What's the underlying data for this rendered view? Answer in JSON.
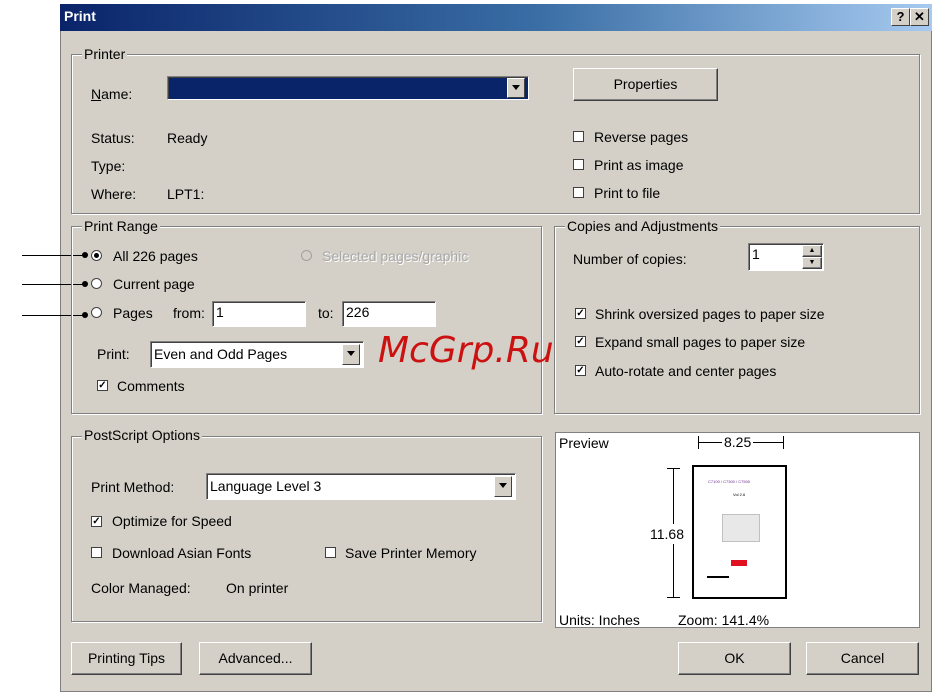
{
  "window": {
    "title": "Print",
    "help_btn": "?",
    "close_btn": "✕"
  },
  "printer": {
    "legend": "Printer",
    "name_label": "Name:",
    "name_value": "",
    "properties_button": "Properties",
    "status_label": "Status:",
    "status_value": "Ready",
    "type_label": "Type:",
    "type_value": "",
    "where_label": "Where:",
    "where_value": "LPT1:",
    "reverse_pages": {
      "label": "Reverse pages",
      "checked": false
    },
    "print_as_image": {
      "label": "Print as image",
      "checked": false
    },
    "print_to_file": {
      "label": "Print to file",
      "checked": false
    }
  },
  "print_range": {
    "legend": "Print Range",
    "all_pages": "All 226 pages",
    "selected": "Selected pages/graphic",
    "current_page": "Current page",
    "pages": "Pages",
    "from_label": "from:",
    "from_value": "1",
    "to_label": "to:",
    "to_value": "226",
    "print_label": "Print:",
    "print_select": "Even and Odd Pages",
    "comments": {
      "label": "Comments",
      "checked": true
    },
    "selected_option": "all"
  },
  "copies": {
    "legend": "Copies and Adjustments",
    "number_label": "Number of copies:",
    "number_value": "1",
    "shrink": {
      "label": "Shrink oversized pages to paper size",
      "checked": true
    },
    "expand": {
      "label": "Expand small pages to paper size",
      "checked": true
    },
    "autorotate": {
      "label": "Auto-rotate and center pages",
      "checked": true
    }
  },
  "postscript": {
    "legend": "PostScript Options",
    "method_label": "Print Method:",
    "method_value": "Language Level 3",
    "optimize": {
      "label": "Optimize for Speed",
      "checked": true
    },
    "asian_fonts": {
      "label": "Download Asian Fonts",
      "checked": false
    },
    "save_memory": {
      "label": "Save Printer Memory",
      "checked": false
    },
    "color_label": "Color Managed:",
    "color_value": "On printer"
  },
  "preview": {
    "label": "Preview",
    "width": "8.25",
    "height": "11.68",
    "units": "Units: Inches",
    "zoom": "Zoom: 141.4%",
    "thumb_title": "C7100 / C7300 / C7500",
    "thumb_subtitle": "Vol 2.6"
  },
  "buttons": {
    "tips": "Printing Tips",
    "advanced": "Advanced...",
    "ok": "OK",
    "cancel": "Cancel"
  },
  "watermark": "McGrp.Ru"
}
